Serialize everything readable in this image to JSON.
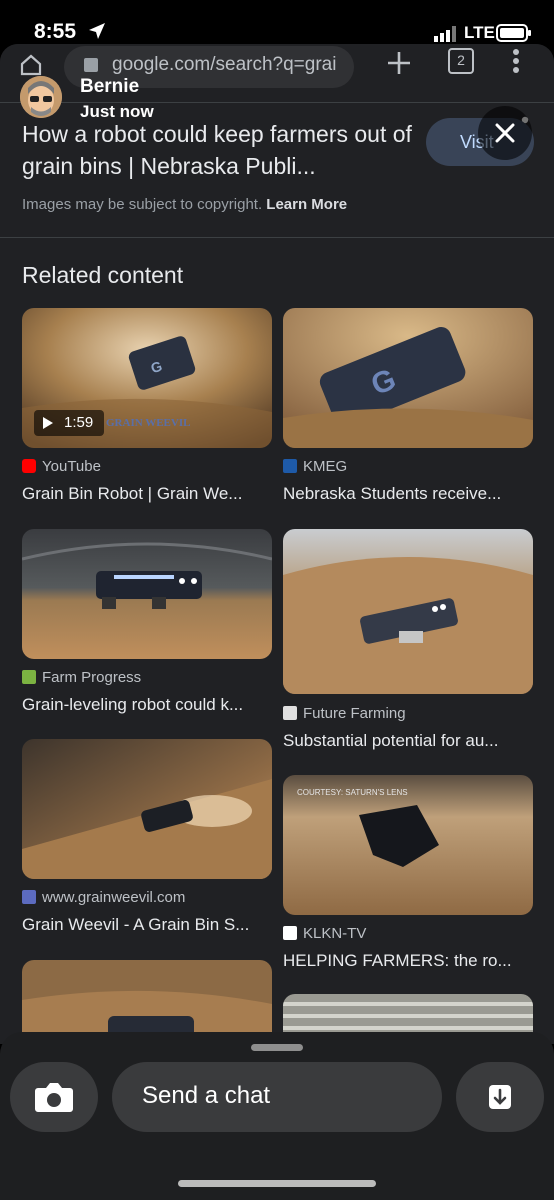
{
  "status_bar": {
    "time": "8:55",
    "network": "LTE"
  },
  "browser": {
    "url": "google.com/search?q=grai",
    "tab_count": "2"
  },
  "story": {
    "username": "Bernie",
    "timestamp": "Just now"
  },
  "result": {
    "title": "How a robot could keep farmers out of grain bins | Nebraska Publi...",
    "visit_label": "Visit",
    "copyright_text": "Images may be subject to copyright.",
    "learn_more": "Learn More"
  },
  "related": {
    "heading": "Related content",
    "left_column": [
      {
        "source": "YouTube",
        "title": "Grain Bin Robot | Grain We...",
        "duration": "1:59",
        "watermark": "GRAIN WEEVIL",
        "fav_color": "#ff0000"
      },
      {
        "source": "Farm Progress",
        "title": "Grain-leveling robot could k...",
        "fav_color": "#7cb342"
      },
      {
        "source": "www.grainweevil.com",
        "title": "Grain Weevil - A Grain Bin S...",
        "fav_color": "#5c6bc0"
      }
    ],
    "right_column": [
      {
        "source": "KMEG",
        "title": "Nebraska Students receive...",
        "fav_color": "#1e5aa8"
      },
      {
        "source": "Future Farming",
        "title": "Substantial potential for au...",
        "fav_color": "#e0e0e0"
      },
      {
        "source": "KLKN-TV",
        "title": "HELPING FARMERS: the ro...",
        "watermark": "COURTESY: SATURN'S LENS",
        "fav_color": "#ffffff"
      }
    ]
  },
  "chat_bar": {
    "placeholder": "Send a chat"
  },
  "colors": {
    "accent_visit": "#394457",
    "background": "#202124"
  }
}
